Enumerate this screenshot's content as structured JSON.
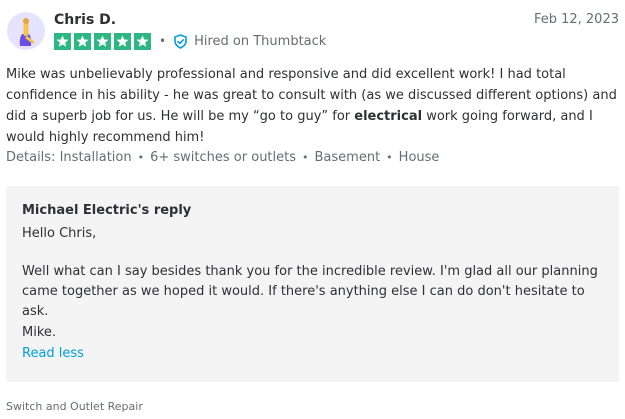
{
  "reviewer": {
    "name": "Chris D.",
    "date": "Feb 12, 2023",
    "rating": 5,
    "hired_label": "Hired on Thumbtack"
  },
  "review": {
    "text_before": "Mike was unbelievably professional and responsive and did excellent work! I had total confidence in his ability - he was great to consult with (as we discussed different options) and did a superb job for us. He will be my “go to guy” for ",
    "text_bold": "electrical",
    "text_after": " work going forward, and I would highly recommend him!"
  },
  "details": {
    "label": "Details:",
    "items": [
      "Installation",
      "6+ switches or outlets",
      "Basement",
      "House"
    ],
    "separator": "•"
  },
  "reply": {
    "title": "Michael Electric's reply",
    "greeting": "Hello Chris,",
    "body": "Well what can I say besides thank you for the incredible review. I'm glad all our planning came together as we hoped it would. If there's anything else I can do don't hesitate to ask.",
    "signoff": "Mike.",
    "read_less_label": "Read less"
  },
  "service": {
    "name": "Switch and Outlet Repair"
  },
  "colors": {
    "star": "#2db783",
    "link": "#009fd9",
    "muted": "#676d73",
    "reply_bg": "#f4f4f4"
  }
}
